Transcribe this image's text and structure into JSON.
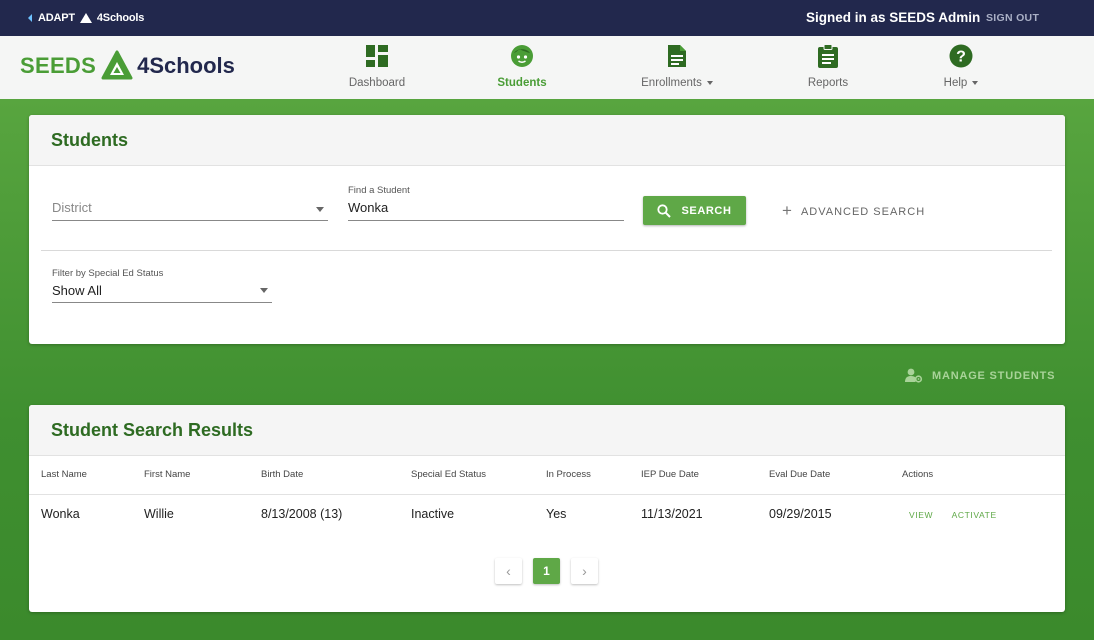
{
  "topbar": {
    "back_label_a": "ADAPT",
    "back_label_b": "4Schools",
    "signed_in": "Signed in as SEEDS Admin",
    "sign_out": "SIGN OUT"
  },
  "logo": {
    "left": "SEEDS",
    "right": "4Schools"
  },
  "nav": [
    {
      "label": "Dashboard",
      "icon": "dashboard-icon"
    },
    {
      "label": "Students",
      "icon": "student-face-icon",
      "active": true
    },
    {
      "label": "Enrollments",
      "icon": "document-icon",
      "dropdown": true
    },
    {
      "label": "Reports",
      "icon": "clipboard-icon"
    },
    {
      "label": "Help",
      "icon": "help-icon",
      "dropdown": true
    }
  ],
  "students_card": {
    "title": "Students",
    "district_placeholder": "District",
    "find_label": "Find a Student",
    "find_value": "Wonka",
    "search_button": "SEARCH",
    "advanced_search": "ADVANCED SEARCH",
    "filter_label": "Filter by Special Ed Status",
    "filter_value": "Show All"
  },
  "manage_students": "MANAGE STUDENTS",
  "results_card": {
    "title": "Student Search Results",
    "columns": [
      "Last Name",
      "First Name",
      "Birth Date",
      "Special Ed Status",
      "In Process",
      "IEP Due Date",
      "Eval Due Date",
      "Actions"
    ],
    "rows": [
      {
        "last_name": "Wonka",
        "first_name": "Willie",
        "birth_date": "8/13/2008 (13)",
        "special_ed_status": "Inactive",
        "in_process": "Yes",
        "iep_due_date": "11/13/2021",
        "eval_due_date": "09/29/2015",
        "action_view": "VIEW",
        "action_activate": "ACTIVATE"
      }
    ],
    "pagination": {
      "prev": "‹",
      "current": "1",
      "next": "›"
    }
  },
  "colors": {
    "brand_green": "#4a9d36",
    "header_dark": "#22284d",
    "button_green": "#5fa847"
  }
}
